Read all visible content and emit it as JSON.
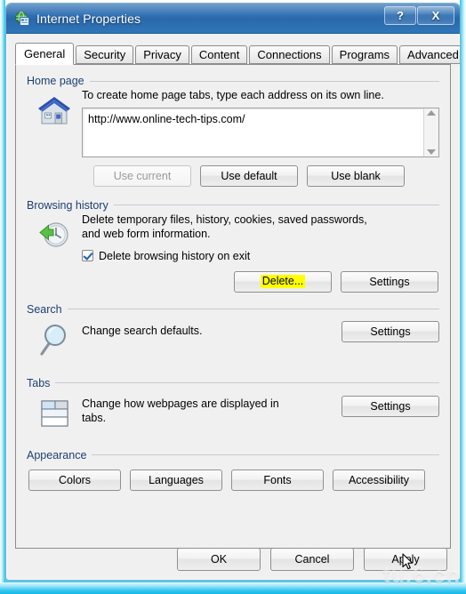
{
  "window": {
    "title": "Internet Properties",
    "icon": "internet-properties-icon",
    "help_label": "?",
    "close_label": "X"
  },
  "tabs": [
    {
      "label": "General",
      "selected": true
    },
    {
      "label": "Security",
      "selected": false
    },
    {
      "label": "Privacy",
      "selected": false
    },
    {
      "label": "Content",
      "selected": false
    },
    {
      "label": "Connections",
      "selected": false
    },
    {
      "label": "Programs",
      "selected": false
    },
    {
      "label": "Advanced",
      "selected": false
    }
  ],
  "groups": {
    "home_page": {
      "title": "Home page",
      "icon": "home-icon",
      "description": "To create home page tabs, type each address on its own line.",
      "address_value": "http://www.online-tech-tips.com/",
      "buttons": [
        {
          "label": "Use current",
          "disabled": true
        },
        {
          "label": "Use default",
          "disabled": false
        },
        {
          "label": "Use blank",
          "disabled": false
        }
      ]
    },
    "browsing_history": {
      "title": "Browsing history",
      "icon": "history-clock-icon",
      "description_line1": "Delete temporary files, history, cookies, saved passwords,",
      "description_line2": "and web form information.",
      "checkbox_label": "Delete browsing history on exit",
      "checkbox_checked": true,
      "delete_button": "Delete...",
      "delete_highlighted": true,
      "settings_button": "Settings"
    },
    "search": {
      "title": "Search",
      "icon": "magnifier-icon",
      "description": "Change search defaults.",
      "settings_button": "Settings"
    },
    "tabs_group": {
      "title": "Tabs",
      "icon": "tabs-icon",
      "description_line1": "Change how webpages are displayed in",
      "description_line2": "tabs.",
      "settings_button": "Settings"
    },
    "appearance": {
      "title": "Appearance",
      "buttons": [
        {
          "label": "Colors"
        },
        {
          "label": "Languages"
        },
        {
          "label": "Fonts"
        },
        {
          "label": "Accessibility"
        }
      ]
    }
  },
  "footer": {
    "ok_label": "OK",
    "cancel_label": "Cancel",
    "apply_label": "Apply"
  },
  "watermark": {
    "text": "tu.6.cn"
  },
  "colors": {
    "titlebar_blue": "#2e6fb3",
    "group_title": "#1c3f73",
    "highlight_yellow": "#ffff00",
    "dialog_face": "#f0f0f0",
    "glass_aqua": "#22c4ee"
  }
}
